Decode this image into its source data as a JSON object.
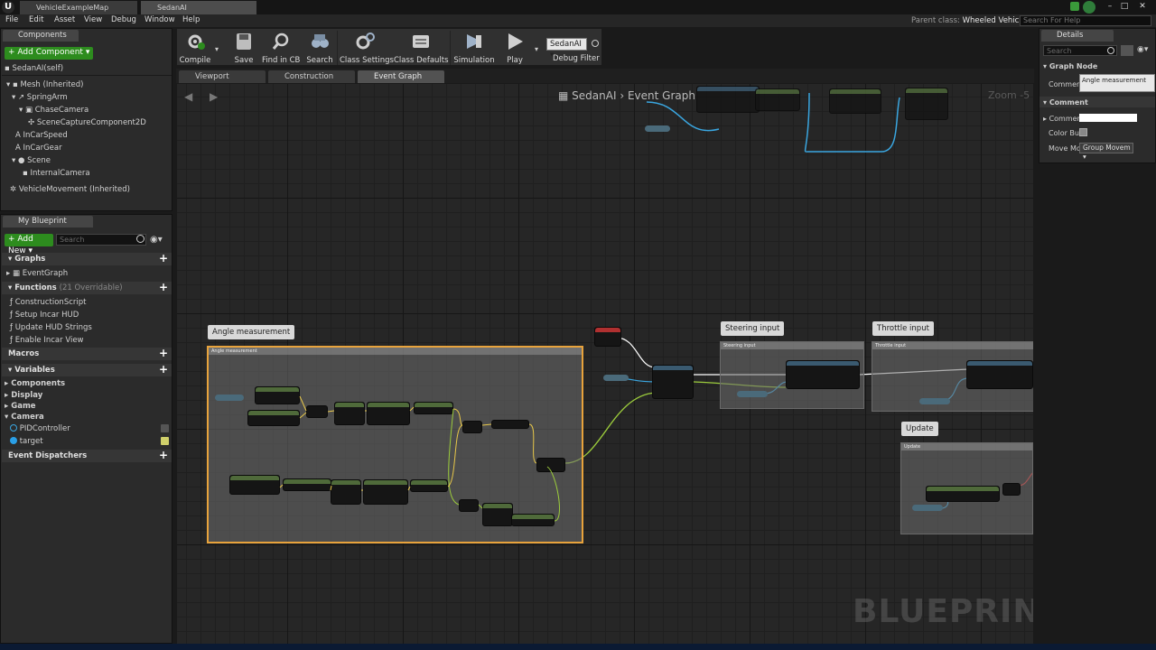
{
  "window": {
    "tabs": [
      "VehicleExampleMap",
      "SedanAI"
    ],
    "controls": [
      "–",
      "□",
      "✕"
    ]
  },
  "menu": [
    "File",
    "Edit",
    "Asset",
    "View",
    "Debug",
    "Window",
    "Help"
  ],
  "parent_class": {
    "label": "Parent class:",
    "value": "Wheeled Vehicle"
  },
  "help_search": {
    "placeholder": "Search For Help"
  },
  "components": {
    "tab": "Components",
    "add_button": "Add Component",
    "self_item": "SedanAI(self)",
    "tree": [
      "Mesh (Inherited)",
      "SpringArm",
      "ChaseCamera",
      "SceneCaptureComponent2D",
      "InCarSpeed",
      "InCarGear",
      "Scene",
      "InternalCamera",
      "VehicleMovement (Inherited)"
    ]
  },
  "my_blueprint": {
    "tab": "My Blueprint",
    "add_new": "Add New",
    "search_placeholder": "Search",
    "graphs_header": "Graphs",
    "graphs": [
      "EventGraph"
    ],
    "functions_header": "Functions",
    "functions_note": "(21 Overridable)",
    "functions": [
      "ConstructionScript",
      "Setup Incar HUD",
      "Update HUD Strings",
      "Enable Incar View"
    ],
    "macros_header": "Macros",
    "variables_header": "Variables",
    "variable_groups": [
      "Components",
      "Display",
      "Game",
      "Camera"
    ],
    "camera_vars": [
      "PIDController",
      "target"
    ],
    "dispatchers_header": "Event Dispatchers"
  },
  "toolbar": {
    "buttons": [
      "Compile",
      "Save",
      "Find in CB",
      "Search",
      "Class Settings",
      "Class Defaults",
      "Simulation",
      "Play"
    ],
    "debug_select": "SedanAI",
    "debug_label": "Debug Filter"
  },
  "graph_tabs": [
    "Viewport",
    "Construction Script",
    "Event Graph"
  ],
  "graph": {
    "breadcrumb_root": "SedanAI",
    "breadcrumb_sep": "›",
    "breadcrumb_leaf": "Event Graph",
    "zoom": "Zoom -5",
    "watermark": "BLUEPRINT",
    "comments": [
      "Angle measurement",
      "Steering input",
      "Throttle input",
      "Update"
    ]
  },
  "details": {
    "tab": "Details",
    "search_placeholder": "Search",
    "graph_node_header": "Graph Node",
    "comment_label": "Commer",
    "comment_value": "Angle measurement",
    "comment_header": "Comment",
    "comment_color_label": "Commer",
    "color_bubble_label": "Color Bu",
    "move_mode_label": "Move Mo",
    "move_mode_value": "Group Movem"
  },
  "colors": {
    "accent_green": "#2d8c1e",
    "selection_orange": "#e8a33c",
    "exec_white": "#ffffff",
    "float_green": "#9ccc3c",
    "object_blue": "#3aa6e0"
  }
}
